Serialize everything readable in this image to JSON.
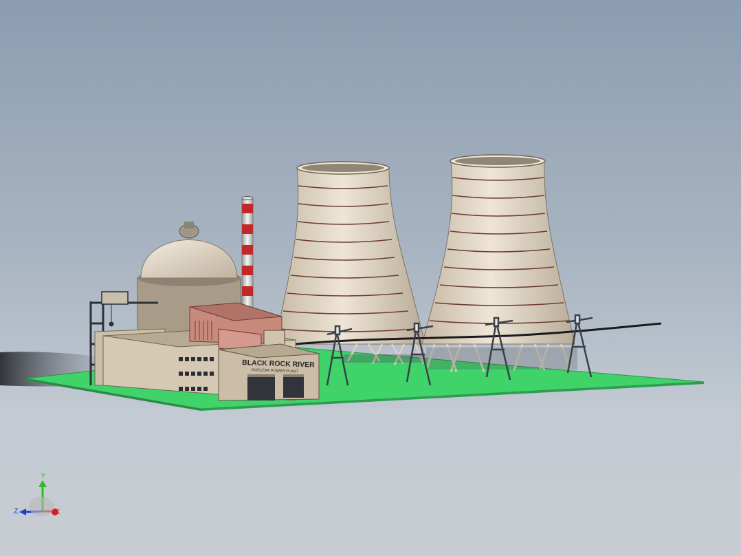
{
  "model": {
    "sign_title": "BLACK ROCK RIVER",
    "sign_subtitle": "NUCLEAR POWER PLANT"
  },
  "triad": {
    "x_label": "X",
    "y_label": "Y",
    "z_label": "Z"
  },
  "colors": {
    "background_top": "#8c9db1",
    "background_bottom": "#c9cdd3",
    "ground": "#3fd36a",
    "concrete": "#d9cfbf",
    "brick": "#c98a7e",
    "stack_red": "#c0282a",
    "axis_x": "#d42020",
    "axis_y": "#2dbb2d",
    "axis_z": "#2040d0"
  }
}
